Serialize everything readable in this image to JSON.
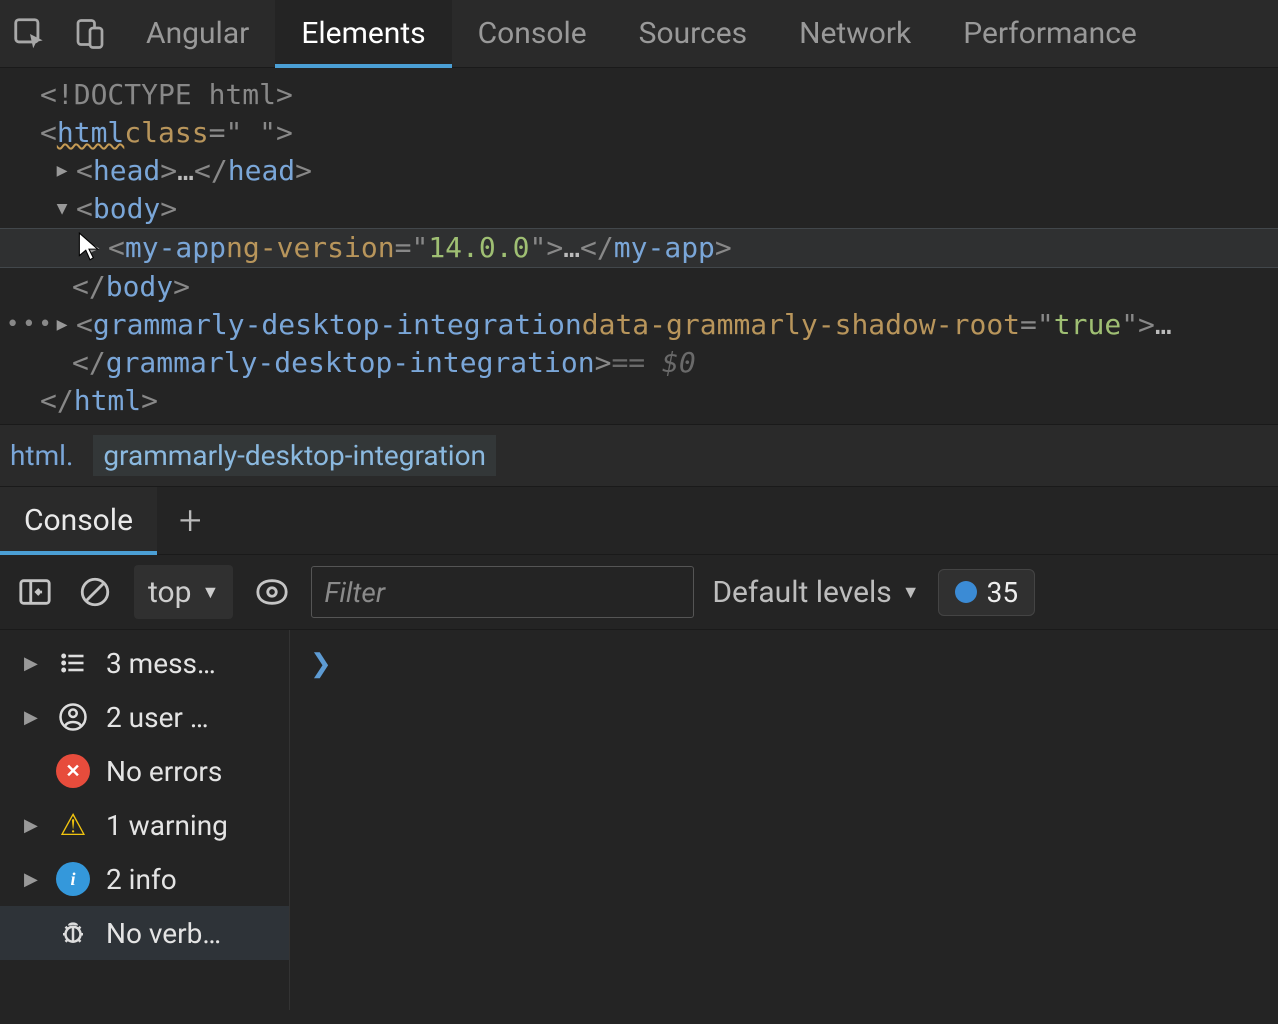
{
  "topbar": {
    "tabs": [
      "Angular",
      "Elements",
      "Console",
      "Sources",
      "Network",
      "Performance"
    ],
    "active": "Elements"
  },
  "dom": {
    "doctype": "<!DOCTYPE html>",
    "html_tag": "html",
    "html_attr_name": "class",
    "html_attr_val": " ",
    "head_tag": "head",
    "body_tag": "body",
    "myapp_tag": "my-app",
    "myapp_attr_name": "ng-version",
    "myapp_attr_val": "14.0.0",
    "grammarly_tag": "grammarly-desktop-integration",
    "grammarly_attr_name": "data-grammarly-shadow-root",
    "grammarly_attr_val": "true",
    "selected_suffix": "== $0"
  },
  "breadcrumb": {
    "crumb1": "html.",
    "crumb2": "grammarly-desktop-integration"
  },
  "drawer": {
    "tab": "Console"
  },
  "console_toolbar": {
    "context": "top",
    "filter_placeholder": "Filter",
    "levels": "Default levels",
    "issue_count": "35"
  },
  "sidebar": {
    "messages": "3 mess…",
    "user": "2 user …",
    "errors": "No errors",
    "warnings": "1 warning",
    "info": "2 info",
    "verbose": "No verb…"
  }
}
